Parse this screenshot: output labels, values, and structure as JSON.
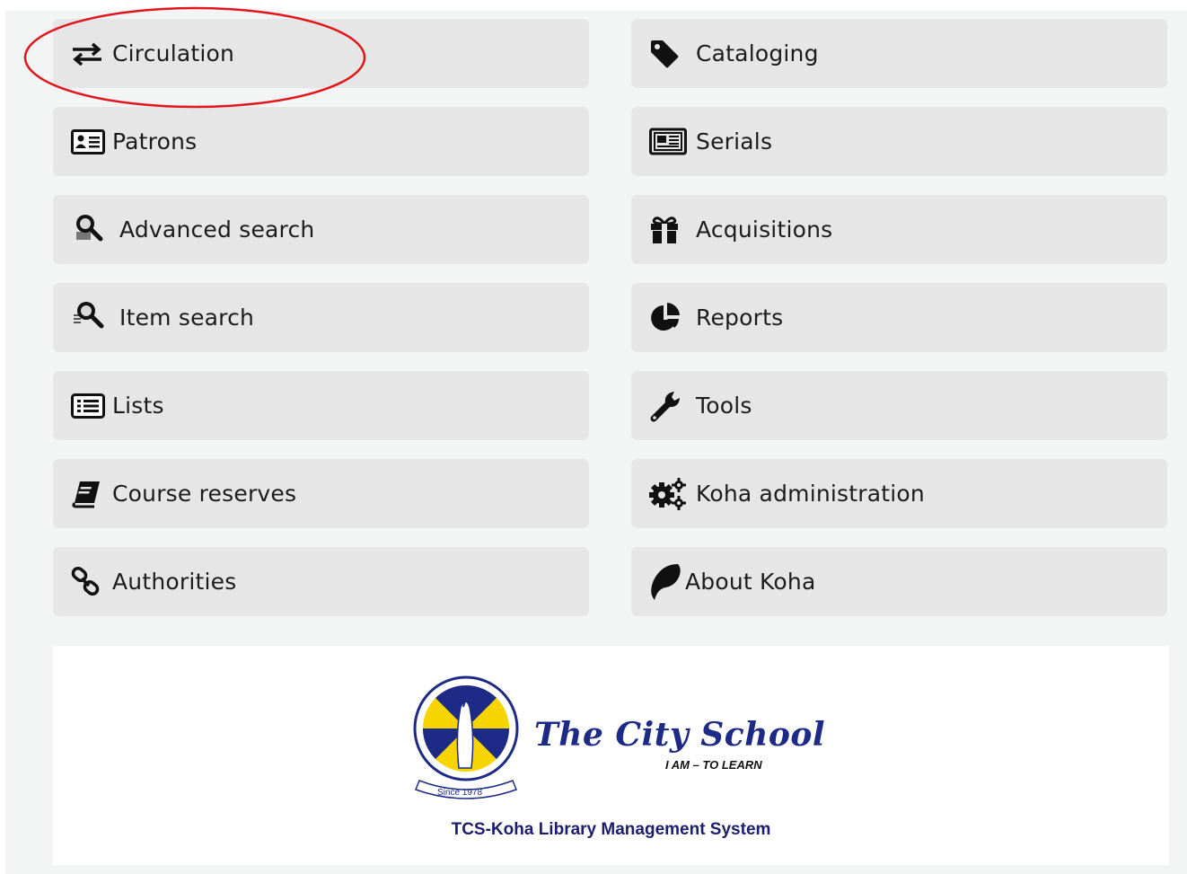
{
  "modules": {
    "left": [
      {
        "label": "Circulation",
        "icon": "exchange-arrows-icon"
      },
      {
        "label": "Patrons",
        "icon": "id-card-icon"
      },
      {
        "label": "Advanced search",
        "icon": "magnifier-search-icon"
      },
      {
        "label": "Item search",
        "icon": "magnifier-list-icon"
      },
      {
        "label": "Lists",
        "icon": "list-alt-icon"
      },
      {
        "label": "Course reserves",
        "icon": "book-icon"
      },
      {
        "label": "Authorities",
        "icon": "chain-link-icon"
      }
    ],
    "right": [
      {
        "label": "Cataloging",
        "icon": "tag-icon"
      },
      {
        "label": "Serials",
        "icon": "newspaper-icon"
      },
      {
        "label": "Acquisitions",
        "icon": "gift-icon"
      },
      {
        "label": "Reports",
        "icon": "pie-chart-icon"
      },
      {
        "label": "Tools",
        "icon": "wrench-icon"
      },
      {
        "label": "Koha administration",
        "icon": "gears-icon"
      },
      {
        "label": "About Koha",
        "icon": "koha-logo-icon"
      }
    ]
  },
  "annotation": {
    "target": "Circulation",
    "color": "#e0161b"
  },
  "footer": {
    "school_name": "The City School",
    "motto": "I AM – TO LEARN",
    "since": "Since 1978",
    "system_name": "TCS-Koha Library Management System"
  },
  "colors": {
    "tile_bg": "#e6e6e6",
    "page_bg": "#f3f4f4",
    "brand_blue": "#1d2a86",
    "brand_yellow": "#f5d400"
  }
}
